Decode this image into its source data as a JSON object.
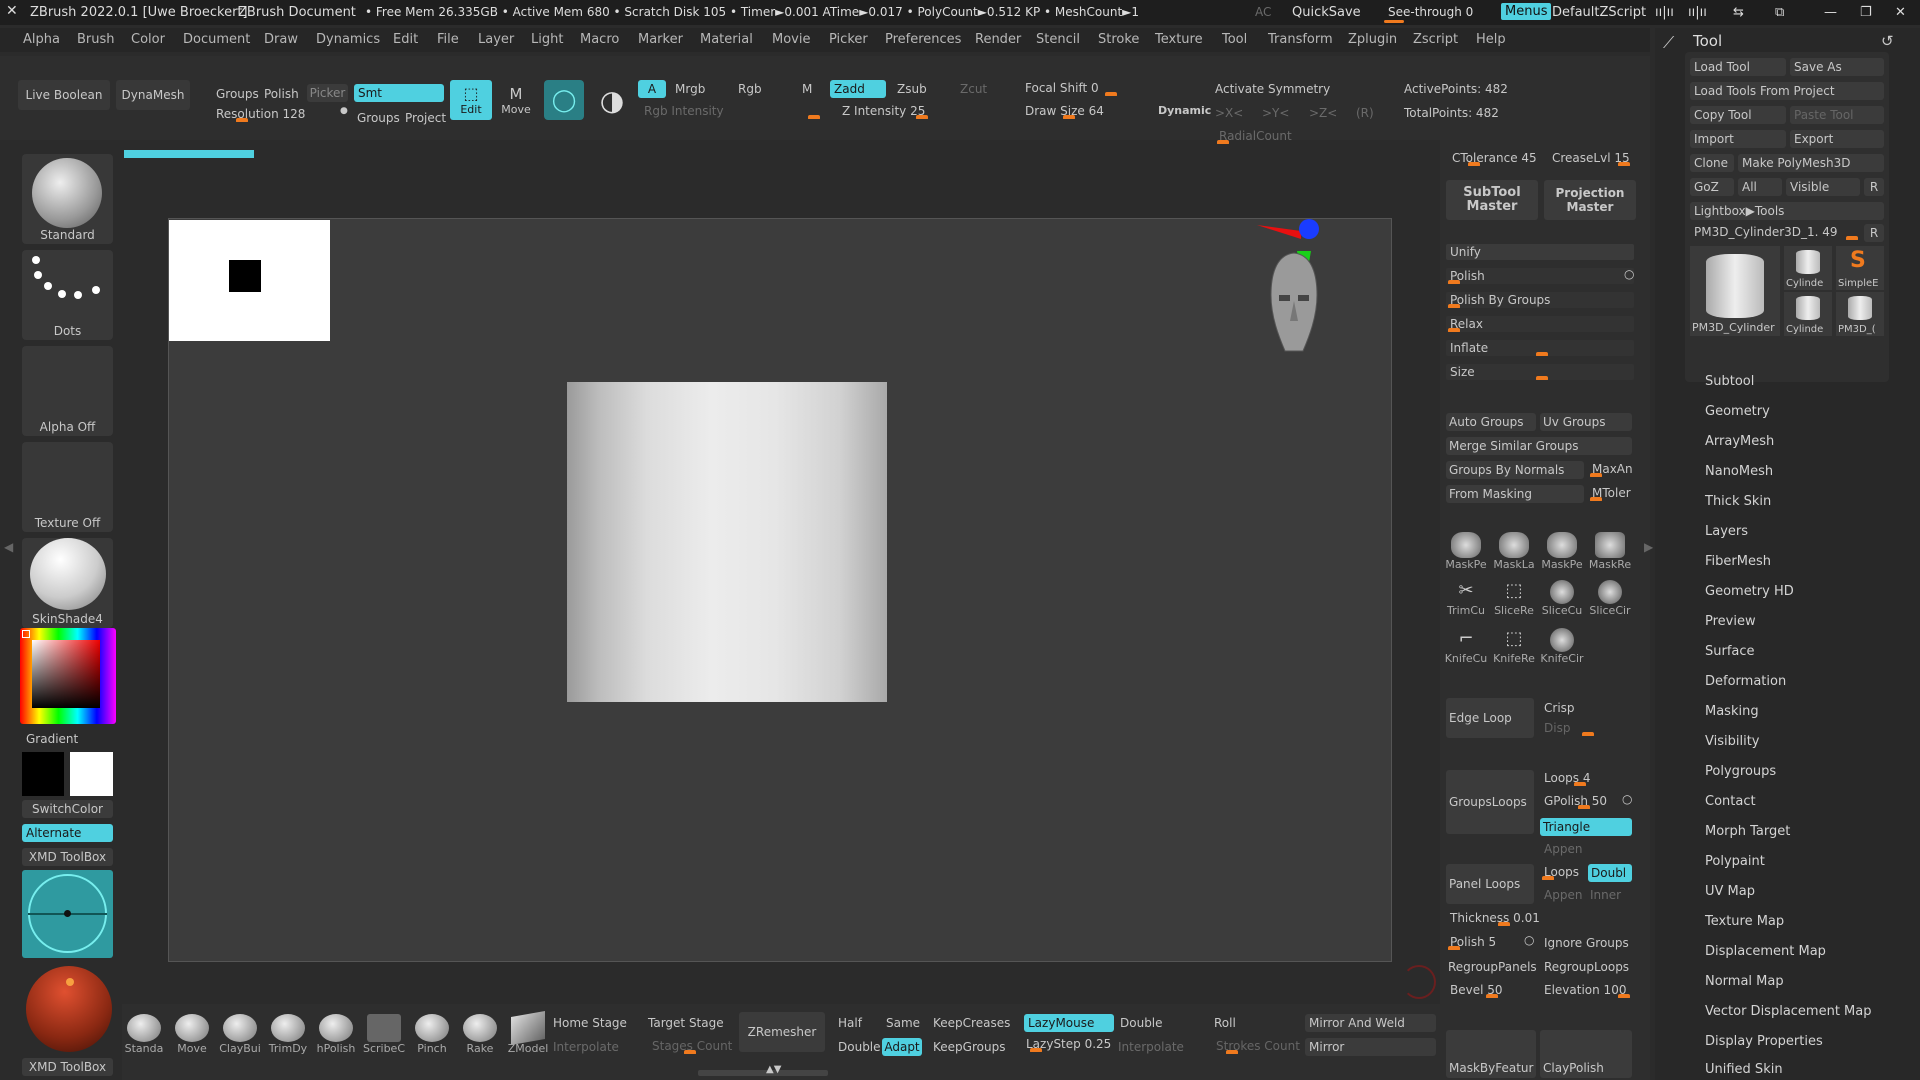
{
  "titlebar": {
    "app": "ZBrush 2022.0.1 [Uwe Broeckert]",
    "doc": "ZBrush Document",
    "stats": "• Free Mem 26.335GB • Active Mem 680 • Scratch Disk 105 • Timer►0.001 ATime►0.017 • PolyCount►0.512 KP • MeshCount►1",
    "ac": "AC",
    "quicksave": "QuickSave",
    "seethrough": "See-through 0",
    "menus": "Menus",
    "script": "DefaultZScript"
  },
  "menubar": [
    "Alpha",
    "Brush",
    "Color",
    "Document",
    "Draw",
    "Dynamics",
    "Edit",
    "File",
    "Layer",
    "Light",
    "Macro",
    "Marker",
    "Material",
    "Movie",
    "Picker",
    "Preferences",
    "Render",
    "Stencil",
    "Stroke",
    "Texture",
    "Tool",
    "Transform",
    "Zplugin",
    "Zscript",
    "Help"
  ],
  "topshelf": {
    "live_boolean": "Live Boolean",
    "dynamesh": "DynaMesh",
    "groups": "Groups",
    "polish": "Polish",
    "picker": "Picker",
    "smt": "Smt",
    "resolution": "Resolution 128",
    "groups2": "Groups",
    "project": "Project",
    "edit": "Edit",
    "move": "Move",
    "a": "A",
    "mrgb": "Mrgb",
    "rgb": "Rgb",
    "m": "M",
    "zadd": "Zadd",
    "zsub": "Zsub",
    "zcut": "Zcut",
    "rgb_intensity": "Rgb Intensity",
    "z_intensity": "Z Intensity 25",
    "focal_shift": "Focal Shift 0",
    "draw_size": "Draw Size 64",
    "dynamic": "Dynamic",
    "activate_symmetry": "Activate Symmetry",
    "x": ">X<",
    "y": ">Y<",
    "z": ">Z<",
    "r": "(R)",
    "radial": "RadialCount",
    "active_points": "ActivePoints: 482",
    "total_points": "TotalPoints: 482"
  },
  "leftshelf": {
    "standard": "Standard",
    "dots": "Dots",
    "alpha_off": "Alpha Off",
    "texture_off": "Texture Off",
    "skinshade": "SkinShade4",
    "gradient": "Gradient",
    "switchcolor": "SwitchColor",
    "alternate": "Alternate",
    "xmd1": "XMD ToolBox",
    "xmd2": "XMD ToolBox"
  },
  "rightshelf": {
    "ctolerance": "CTolerance 45",
    "creaselvl": "CreaseLvl 15",
    "subtool_master": "SubTool Master",
    "projection_master": "Projection Master",
    "unify": "Unify",
    "polish": "Polish",
    "polish_by_groups": "Polish By Groups",
    "relax": "Relax",
    "inflate": "Inflate",
    "size": "Size",
    "auto_groups": "Auto Groups",
    "uv_groups": "Uv Groups",
    "merge_similar": "Merge Similar Groups",
    "groups_by_normals": "Groups By Normals",
    "maxan": "MaxAn",
    "from_masking": "From Masking",
    "mtoler": "MToler",
    "icons": [
      "MaskPe",
      "MaskLa",
      "MaskPe",
      "MaskRe",
      "TrimCu",
      "SliceRe",
      "SliceCu",
      "SliceCir",
      "KnifeCu",
      "KnifeRe",
      "KnifeCir"
    ],
    "edge_loop": "Edge Loop",
    "crisp": "Crisp",
    "disp": "Disp",
    "groupsloops": "GroupsLoops",
    "loops4": "Loops 4",
    "gpolish": "GPolish 50",
    "triangle": "Triangle",
    "append": "Appen",
    "panel_loops": "Panel Loops",
    "loops": "Loops",
    "double": "Doubl",
    "append2": "Appen",
    "inner": "Inner",
    "thickness": "Thickness 0.01",
    "polish5": "Polish 5",
    "ignore_groups": "Ignore Groups",
    "regroup_panels": "RegroupPanels",
    "regroup_loops": "RegroupLoops",
    "bevel": "Bevel 50",
    "elevation": "Elevation 100",
    "maskbyfeat": "MaskByFeatur",
    "claypolish": "ClayPolish"
  },
  "bottomshelf": {
    "brushes": [
      "Standa",
      "Move",
      "ClayBui",
      "TrimDy",
      "hPolish",
      "ScribeC",
      "Pinch",
      "Rake",
      "ZModel"
    ],
    "home_stage": "Home Stage",
    "target_stage": "Target Stage",
    "interpolate": "Interpolate",
    "stages_count": "Stages Count",
    "zremesher": "ZRemesher",
    "half": "Half",
    "same": "Same",
    "double": "Double",
    "adapt": "Adapt",
    "keep_creases": "KeepCreases",
    "keep_groups": "KeepGroups",
    "lazymouse": "LazyMouse",
    "lazystep": "LazyStep 0.25",
    "double2": "Double",
    "interpolate2": "Interpolate",
    "roll": "Roll",
    "strokes_count": "Strokes Count",
    "mirror_weld": "Mirror And Weld",
    "mirror": "Mirror"
  },
  "toolpanel": {
    "title": "Tool",
    "load_tool": "Load Tool",
    "save_as": "Save As",
    "load_from_project": "Load Tools From Project",
    "copy_tool": "Copy Tool",
    "paste_tool": "Paste Tool",
    "import": "Import",
    "export": "Export",
    "clone": "Clone",
    "make_polymesh": "Make PolyMesh3D",
    "goz": "GoZ",
    "all": "All",
    "visible": "Visible",
    "r": "R",
    "lightbox": "Lightbox▶Tools",
    "current_tool": "PM3D_Cylinder3D_1. 49",
    "thumb_labels": [
      "PM3D_Cylinder",
      "Cylinde",
      "SimpleE",
      "Cylinde",
      "PM3D_("
    ],
    "sections": [
      "Subtool",
      "Geometry",
      "ArrayMesh",
      "NanoMesh",
      "Thick Skin",
      "Layers",
      "FiberMesh",
      "Geometry HD",
      "Preview",
      "Surface",
      "Deformation",
      "Masking",
      "Visibility",
      "Polygroups",
      "Contact",
      "Morph Target",
      "Polypaint",
      "UV Map",
      "Texture Map",
      "Displacement Map",
      "Normal Map",
      "Vector Displacement Map",
      "Display Properties",
      "Unified Skin"
    ]
  },
  "colors": {
    "accent": "#4fd0e0",
    "slider": "#f07a1e",
    "bg": "#2b2b2b"
  }
}
